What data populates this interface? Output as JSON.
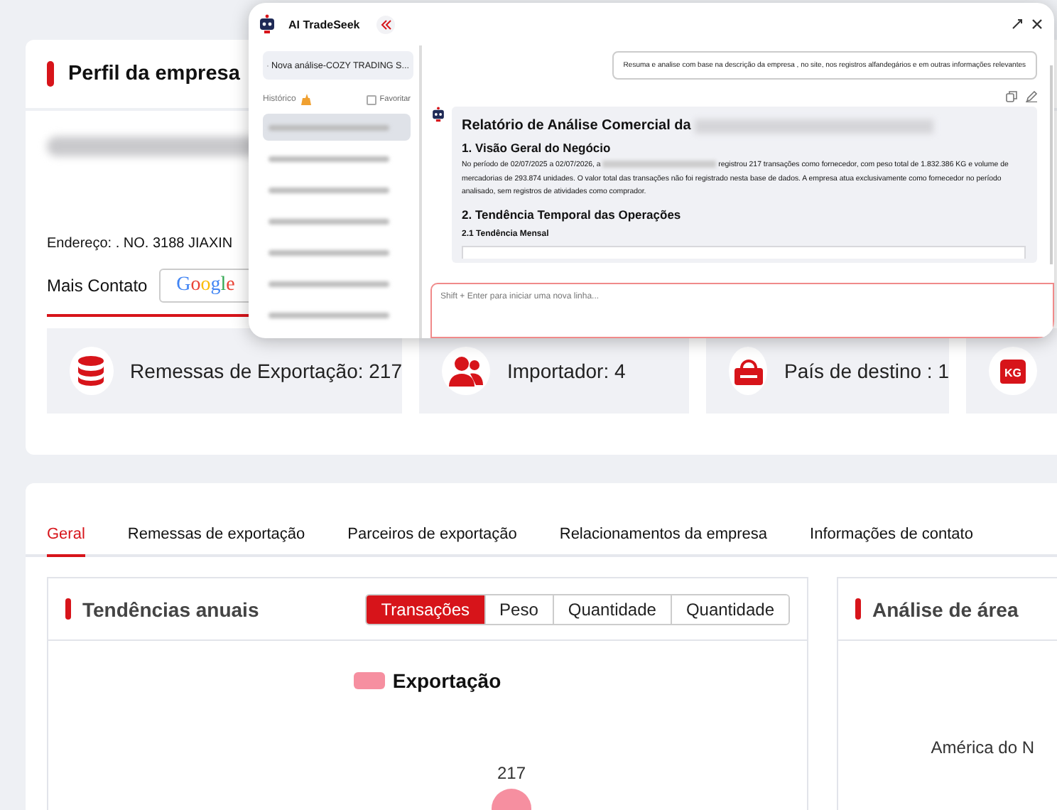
{
  "profile": {
    "title": "Perfil da empresa",
    "address": "Endereço: . NO. 3188 JIAXIN",
    "more_contact": "Mais Contato",
    "google": "Google"
  },
  "stats": [
    {
      "kind": "shipments",
      "label": "Remessas de Exportação: 217"
    },
    {
      "kind": "importer",
      "label": "Importador: 4"
    },
    {
      "kind": "destination",
      "label": "País de destino : 1"
    },
    {
      "kind": "weight",
      "icon_text": "KG"
    }
  ],
  "tabs": [
    {
      "label": "Geral",
      "selected": true
    },
    {
      "label": "Remessas de exportação",
      "selected": false
    },
    {
      "label": "Parceiros de exportação",
      "selected": false
    },
    {
      "label": "Relacionamentos da empresa",
      "selected": false
    },
    {
      "label": "Informações de contato",
      "selected": false
    }
  ],
  "trend": {
    "title": "Tendências anuais",
    "segments": [
      {
        "label": "Transações",
        "selected": true
      },
      {
        "label": "Peso",
        "selected": false
      },
      {
        "label": "Quantidade",
        "selected": false
      },
      {
        "label": "Quantidade",
        "selected": false
      }
    ],
    "legend": "Exportação",
    "point_label": "217"
  },
  "area": {
    "title": "Análise de área",
    "label": "América do N"
  },
  "assistant": {
    "title": "AI TradeSeek",
    "new_analysis": "Nova análise-COZY TRADING S...",
    "history_label": "Histórico",
    "favorite": {
      "label": "Favoritar",
      "checked": false
    },
    "history": [
      {
        "selected": true
      },
      {
        "selected": false
      },
      {
        "selected": false
      },
      {
        "selected": false
      },
      {
        "selected": false
      },
      {
        "selected": false
      },
      {
        "selected": false
      }
    ],
    "user_message": "Resuma e analise com base na descrição da empresa , no site, nos registros alfandegários e em outras informações relevantes",
    "report": {
      "title": "Relatório de Análise Comercial da",
      "h1": "1. Visão Geral do Negócio",
      "para_before": "No período de 02/07/2025 a 02/07/2026, a",
      "para_after": "registrou 217 transações como fornecedor, com peso total de 1.832.386 KG e volume de mercadorias de 293.874 unidades. O valor total das transações não foi registrado nesta base de dados. A empresa atua exclusivamente como fornecedor no período analisado, sem registros de atividades como comprador.",
      "h2": "2. Tendência Temporal das Operações",
      "h3": "2.1 Tendência Mensal"
    },
    "input_placeholder": "Shift + Enter para iniciar uma nova linha..."
  }
}
